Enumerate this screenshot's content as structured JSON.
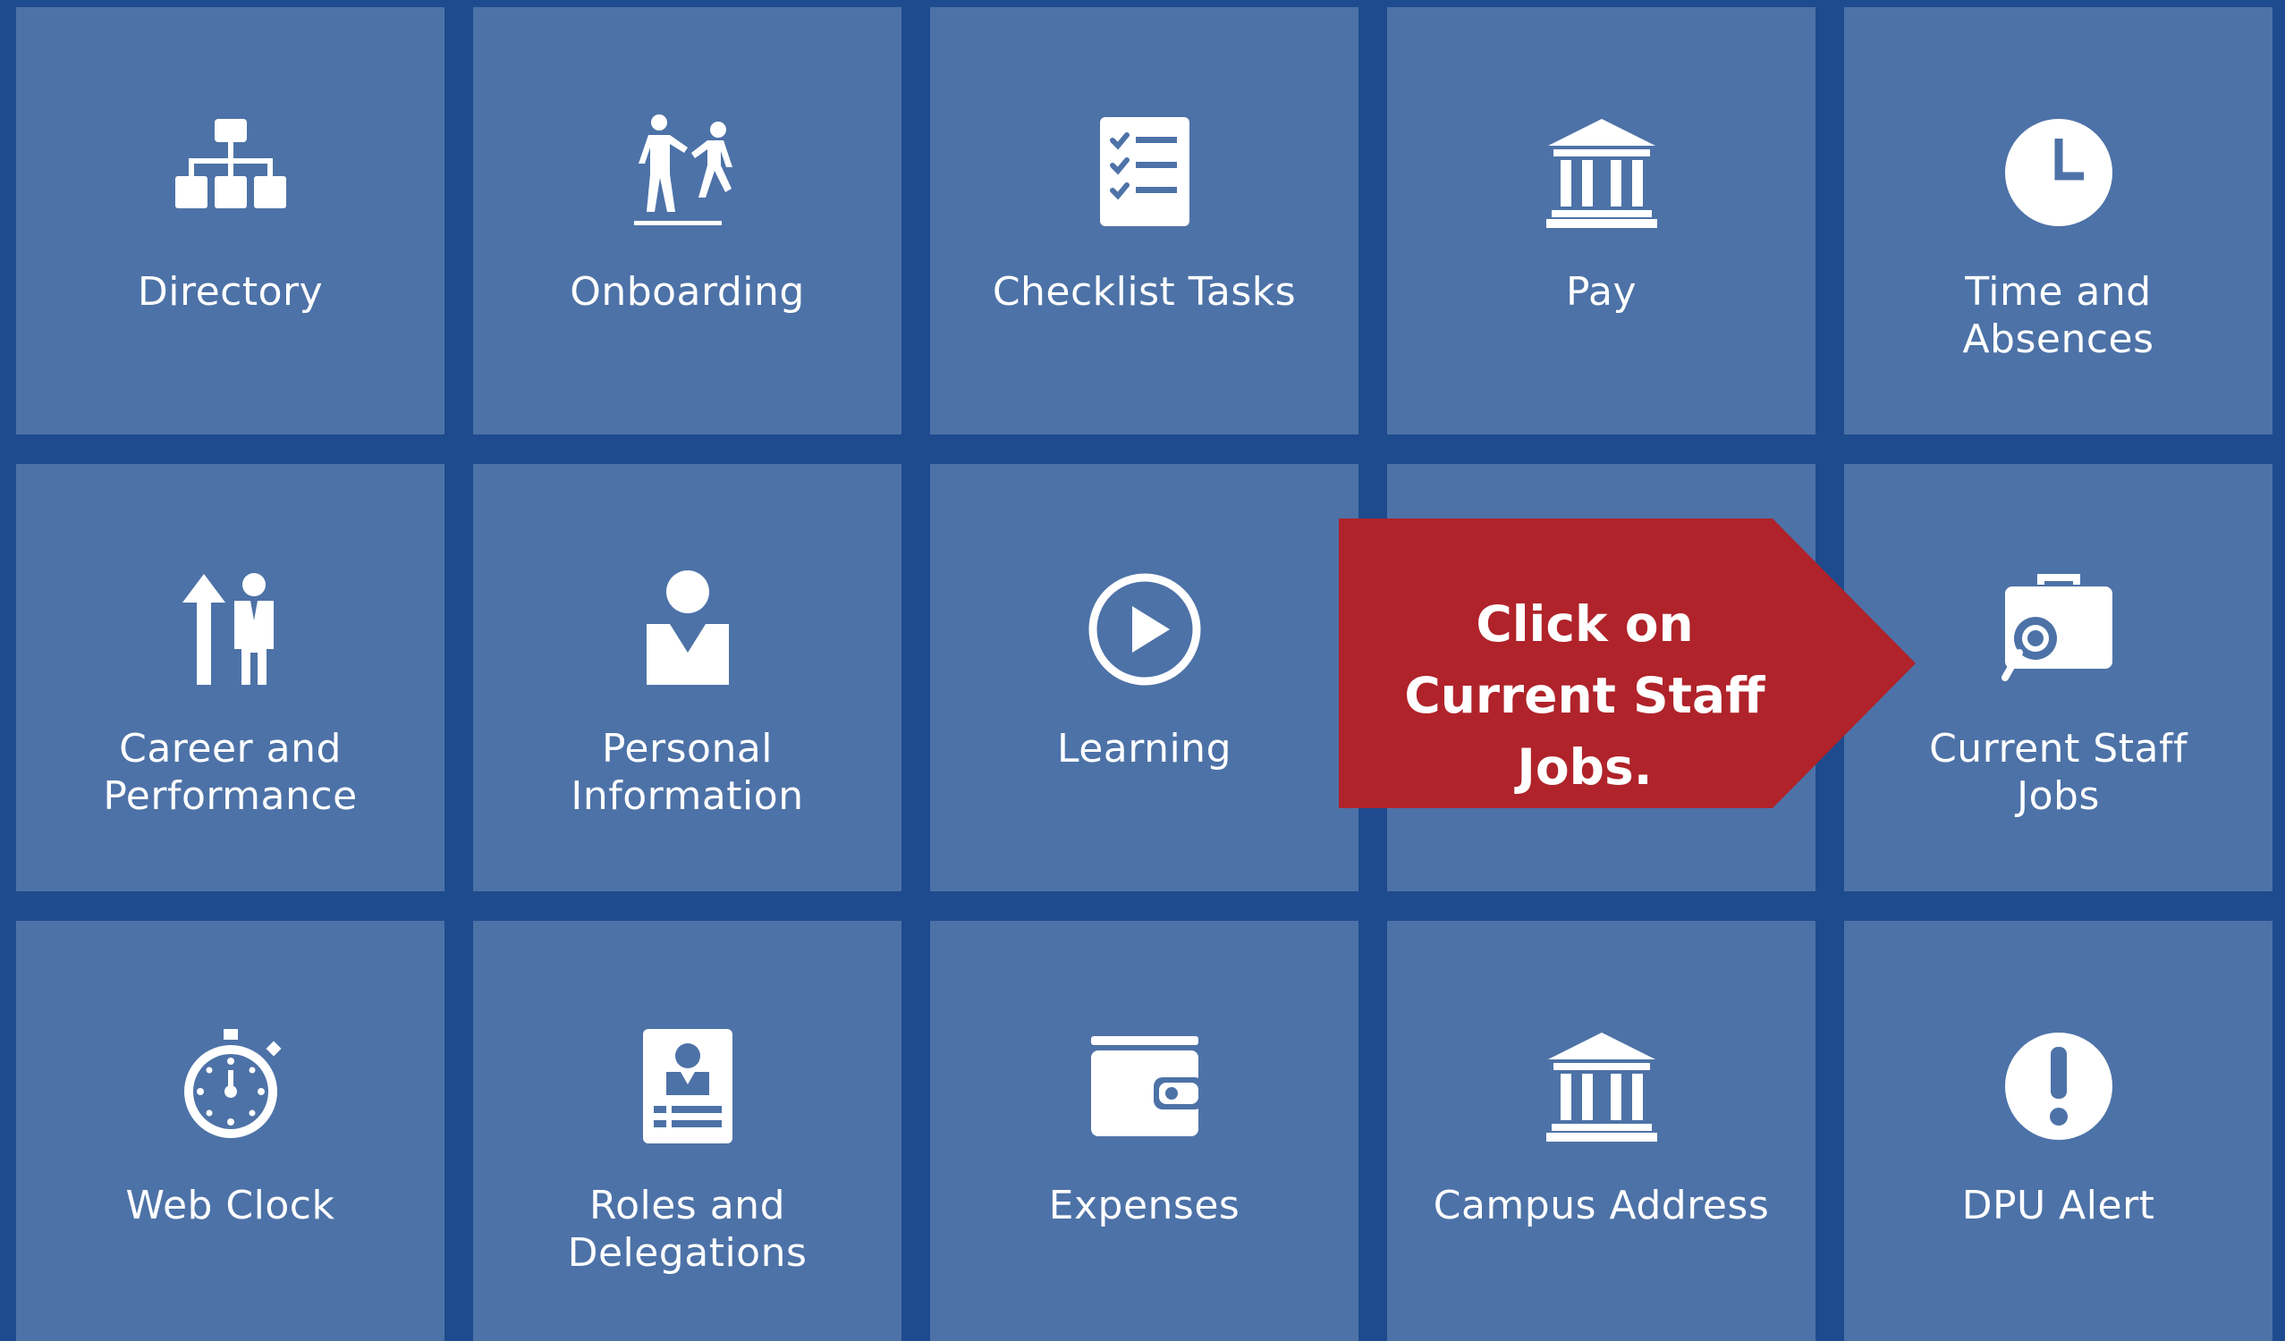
{
  "tiles": {
    "directory": "Directory",
    "onboarding": "Onboarding",
    "checklist_tasks": "Checklist Tasks",
    "pay": "Pay",
    "time_and_absences": "Time and\nAbsences",
    "career_and_performance": "Career and\nPerformance",
    "personal_information": "Personal\nInformation",
    "learning": "Learning",
    "current_staff_jobs": "Current Staff\nJobs",
    "web_clock": "Web Clock",
    "roles_and_delegations": "Roles and\nDelegations",
    "expenses": "Expenses",
    "campus_address": "Campus Address",
    "dpu_alert": "DPU Alert"
  },
  "callout": {
    "line1": "Click on",
    "line2": "Current Staff Jobs."
  },
  "colors": {
    "background": "#1e4b8e",
    "tile": "#4d72a7",
    "callout": "#b0232a",
    "text": "#ffffff"
  },
  "icons": {
    "directory": "org-chart-icon",
    "onboarding": "onboarding-people-icon",
    "checklist_tasks": "checklist-icon",
    "pay": "bank-icon",
    "time_and_absences": "clock-icon",
    "career_and_performance": "career-arrow-person-icon",
    "personal_information": "person-icon",
    "learning": "play-circle-icon",
    "current_staff_jobs": "briefcase-search-icon",
    "web_clock": "stopwatch-icon",
    "roles_and_delegations": "id-badge-icon",
    "expenses": "wallet-icon",
    "campus_address": "bank-icon",
    "dpu_alert": "alert-icon"
  }
}
